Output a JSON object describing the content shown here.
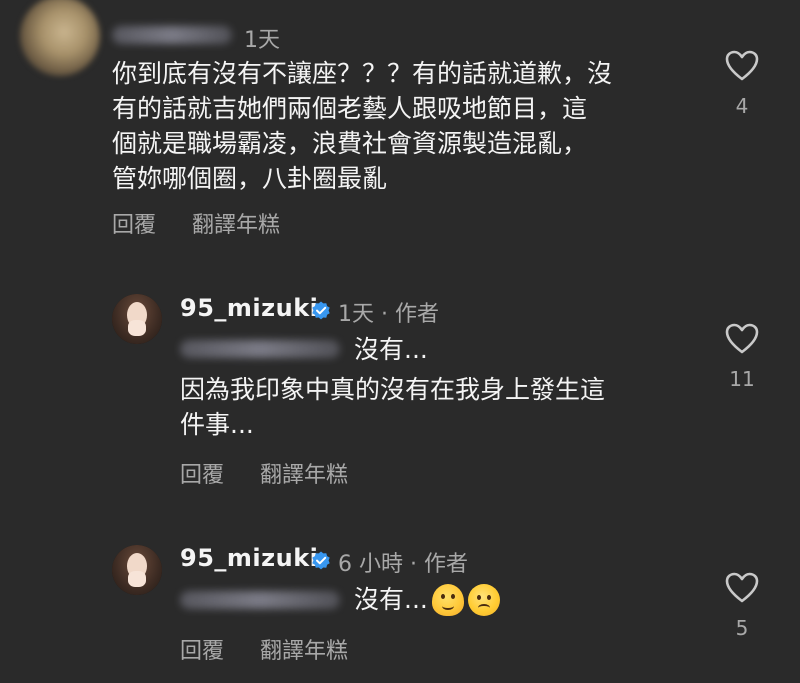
{
  "comments": [
    {
      "time": "1天",
      "text": "你到底有沒有不讓座？？？有的話就道歉，沒\n有的話就吉她們兩個老藝人跟吸地節目，這\n個就是職場霸凌，浪費社會資源製造混亂，\n管妳哪個圈，八卦圈最亂",
      "reply_label": "回覆",
      "translate_label": "翻譯年糕",
      "likes": "4"
    },
    {
      "username": "95_mizuki",
      "meta": "1天 · 作者",
      "mention_text": "沒有...",
      "text": "因為我印象中真的沒有在我身上發生這\n件事...",
      "reply_label": "回覆",
      "translate_label": "翻譯年糕",
      "likes": "11"
    },
    {
      "username": "95_mizuki",
      "meta": "6 小時 · 作者",
      "mention_text": "沒有...",
      "emojis": [
        "melting-face",
        "worried-face"
      ],
      "reply_label": "回覆",
      "translate_label": "翻譯年糕",
      "likes": "5"
    }
  ],
  "colors": {
    "background": "#2a2a2a",
    "text": "#f4f4f4",
    "secondary": "#a8a8a8",
    "verified": "#3897f0"
  }
}
